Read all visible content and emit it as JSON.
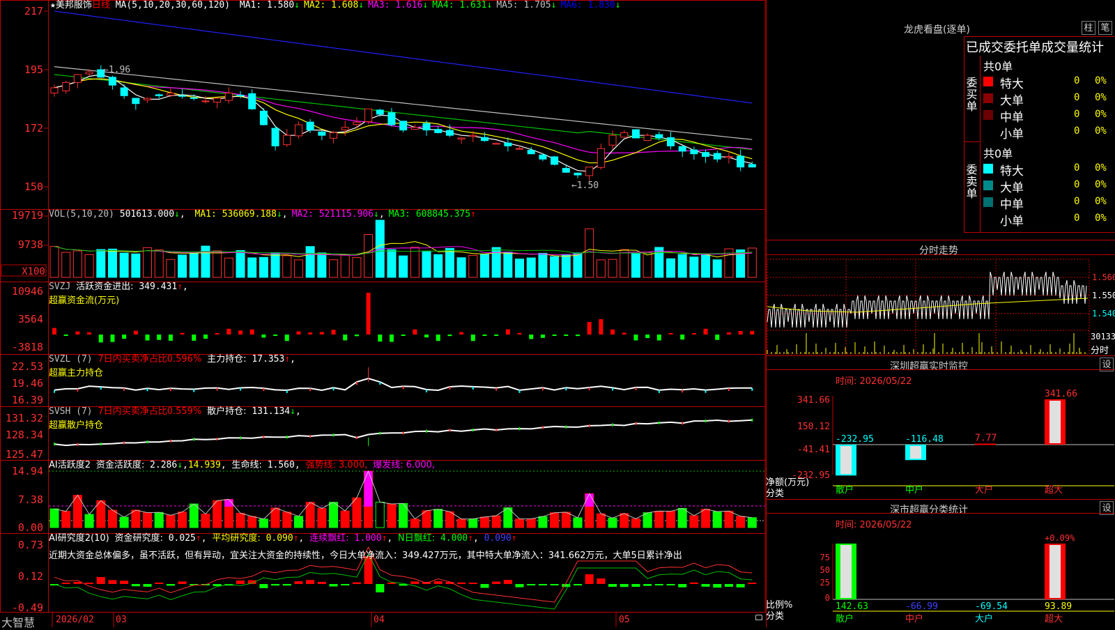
{
  "stock": {
    "star": "★",
    "name": "美邦服饰",
    "period": "日线"
  },
  "ma_header": {
    "label": "MA(5,10,20,30,60,120)",
    "items": [
      {
        "name": "MA1:",
        "value": "1.580",
        "arrow": "↓",
        "color": "#ffffff"
      },
      {
        "name": "MA2:",
        "value": "1.608",
        "arrow": "↓",
        "color": "#ffff00"
      },
      {
        "name": "MA3:",
        "value": "1.616",
        "arrow": "↓",
        "color": "#ff00ff"
      },
      {
        "name": "MA4:",
        "value": "1.631",
        "arrow": "↓",
        "color": "#00ff00"
      },
      {
        "name": "MA5:",
        "value": "1.705",
        "arrow": "↓",
        "color": "#c0c0c0"
      },
      {
        "name": "MA6:",
        "value": "1.830",
        "arrow": "↓",
        "color": "#0000ff"
      }
    ]
  },
  "price_axis": [
    "217",
    "195",
    "172",
    "150"
  ],
  "price_marks": {
    "high": "1.96",
    "low": "1.50"
  },
  "vol_header": {
    "label": "VOL(5,10,20)",
    "value": "501613.000",
    "arrow": "↓",
    "items": [
      {
        "name": "MA1:",
        "value": "536069.188",
        "arrow": "↓",
        "color": "#ffff00"
      },
      {
        "name": "MA2:",
        "value": "521115.906",
        "arrow": "↓",
        "color": "#ff00ff"
      },
      {
        "name": "MA3:",
        "value": "608845.375",
        "arrow": "↑",
        "color": "#00ff00"
      }
    ]
  },
  "vol_axis": [
    "19719",
    "9738"
  ],
  "vol_unit": "X100",
  "svzj": {
    "label": "SVZJ",
    "title": "活跃资金进出:",
    "value": "349.431",
    "arrow": "↑",
    "tail": ",",
    "sub": "超赢资金流(万元)",
    "axis": [
      "10946",
      "3564",
      "-3818"
    ]
  },
  "svzl": {
    "label": "SVZL (7)",
    "title": "7日内买卖净占比0.596%",
    "title2": "主力持仓:",
    "value": "17.353",
    "arrow": "↑",
    "tail": ",",
    "sub": "超赢主力持仓",
    "axis": [
      "22.53",
      "19.46",
      "16.39"
    ]
  },
  "svsh": {
    "label": "SVSH (7)",
    "title": "7日内买卖净占比0.559%",
    "title2": "散户持仓:",
    "value": "131.134",
    "arrow": "↓",
    "tail": ",",
    "sub": "超赢散户持仓",
    "axis": [
      "131.32",
      "128.34",
      "125.47"
    ]
  },
  "ai_active": {
    "label": "AI活跃度2",
    "title": "资金活跃度:",
    "value": "2.286",
    "arrow": "↓",
    "v2": "14.939",
    "life": "生命线:",
    "life_v": "1.560,",
    "strong": "强势线: 3.000,",
    "burst": "爆发线: 6.000,",
    "axis": [
      "14.94",
      "7.38",
      "0.00"
    ]
  },
  "ai_research": {
    "label": "AI研究度2(10)",
    "title": "资金研究度:",
    "value": "0.025",
    "arrow": "↑",
    "avg": "平均研究度:",
    "avg_v": "0.090",
    "avg_a": "↑",
    "red": "连续飘红:",
    "red_v": "1.000",
    "red_a": "↑",
    "nred": "N日飘红:",
    "nred_v": "4.000",
    "nred_a": "↑",
    "last": "0.090",
    "last_a": "↑",
    "text": "近期大资金总体偏多，虽不活跃，但有异动，宜关注大资金的持续性，今日大单净流入：349.427万元，其中特大单净流入：341.662万元，大单5日累计净出",
    "axis": [
      "0.73",
      "0.12",
      "-0.49"
    ]
  },
  "date_axis": {
    "brand": "大智慧",
    "labels": [
      "2026/02",
      "03",
      "04",
      "05"
    ]
  },
  "right": {
    "lhb_title": "龙虎看盘(逐单)",
    "btn_column": "柱",
    "btn_pen": "笔",
    "stats_title": "已成交委托单成交量统计",
    "buy": {
      "side": "委买单",
      "total": "共0单",
      "rows": [
        {
          "name": "特大",
          "n": "0",
          "pct": "0%",
          "color": "#ff0000"
        },
        {
          "name": "大单",
          "n": "0",
          "pct": "0%",
          "color": "#8b0000"
        },
        {
          "name": "中单",
          "n": "0",
          "pct": "0%",
          "color": "#6b0000"
        },
        {
          "name": "小单",
          "n": "0",
          "pct": "0%",
          "color": ""
        }
      ]
    },
    "sell": {
      "side": "委卖单",
      "total": "共0单",
      "rows": [
        {
          "name": "特大",
          "n": "0",
          "pct": "0%",
          "color": "#00ffff"
        },
        {
          "name": "大单",
          "n": "0",
          "pct": "0%",
          "color": "#008b8b"
        },
        {
          "name": "中单",
          "n": "0",
          "pct": "0%",
          "color": "#007070"
        },
        {
          "name": "小单",
          "n": "0",
          "pct": "0%",
          "color": ""
        }
      ]
    },
    "intraday_title": "分时走势",
    "intraday_axis": [
      "1.560",
      "1.550",
      "1.540"
    ],
    "intraday_vol": "30133",
    "intraday_tag": "分时",
    "monitor": {
      "title": "深圳超赢实时监控",
      "set": "设",
      "time": "时间: 2026/05/22",
      "axis": [
        "341.66",
        "150.12",
        "-41.41",
        "-232.95"
      ],
      "ylabel1": "净额(万元)",
      "ylabel2": "分类",
      "bars": [
        {
          "cat": "散户",
          "value": -232.95,
          "label": "-232.95",
          "color": "#00ffff"
        },
        {
          "cat": "中户",
          "value": -116.48,
          "label": "-116.48",
          "color": "#00ffff"
        },
        {
          "cat": "大户",
          "value": 7.77,
          "label": "7.77",
          "color": "#ff0000"
        },
        {
          "cat": "超大",
          "value": 341.66,
          "label": "341.66",
          "color": "#ff0000"
        }
      ]
    },
    "classify": {
      "title": "深市超赢分类统计",
      "set": "设",
      "time": "时间: 2026/05/22",
      "axis": [
        "75",
        "50",
        "25",
        "0"
      ],
      "ylabel1": "比例%",
      "ylabel2": "分类",
      "top_label": "+0.09%",
      "bars": [
        {
          "cat": "散户",
          "value": 142.63,
          "label": "142.63",
          "color": "#00ff00"
        },
        {
          "cat": "中户",
          "value": -66.99,
          "label": "-66.99",
          "color": "#4040ff"
        },
        {
          "cat": "大户",
          "value": -69.54,
          "label": "-69.54",
          "color": "#00ffff"
        },
        {
          "cat": "超大",
          "value": 93.89,
          "label": "93.89",
          "color": "#ffff00"
        }
      ]
    }
  },
  "colors": {
    "up": "#ff3030",
    "down": "#00ffff",
    "grid": "#c00000",
    "text": "#c0c0c0"
  }
}
